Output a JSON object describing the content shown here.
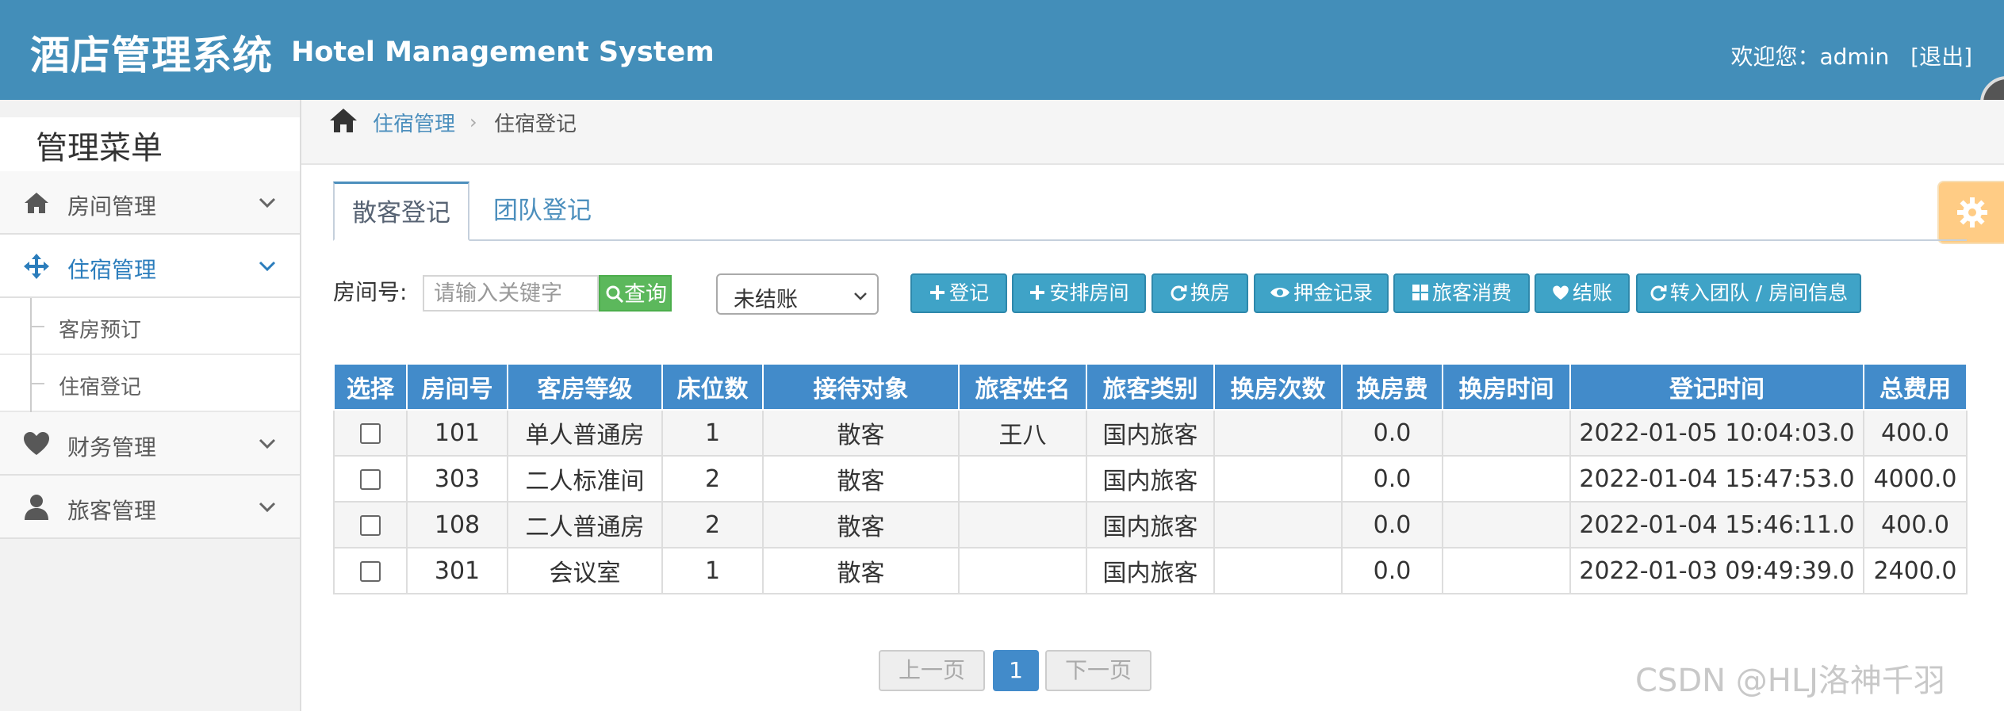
{
  "header": {
    "title_cn": "酒店管理系统",
    "title_en": "Hotel Management System",
    "welcome": "欢迎您：admin",
    "logout": "[退出]"
  },
  "sidebar": {
    "title": "管理菜单",
    "items": [
      {
        "label": "房间管理",
        "icon": "home-icon"
      },
      {
        "label": "住宿管理",
        "icon": "move-icon",
        "active": true
      },
      {
        "label": "财务管理",
        "icon": "heart-icon"
      },
      {
        "label": "旅客管理",
        "icon": "user-icon"
      }
    ],
    "subitems": [
      {
        "label": "客房预订"
      },
      {
        "label": "住宿登记"
      }
    ]
  },
  "breadcrumb": {
    "parent": "住宿管理",
    "current": "住宿登记"
  },
  "tabs": [
    {
      "label": "散客登记",
      "active": true
    },
    {
      "label": "团队登记",
      "active": false
    }
  ],
  "search": {
    "label": "房间号:",
    "placeholder": "请输入关键字",
    "button": "查询"
  },
  "status_select": {
    "value": "未结账"
  },
  "actions": [
    {
      "label": "登记",
      "icon": "plus-icon"
    },
    {
      "label": "安排房间",
      "icon": "plus-icon"
    },
    {
      "label": "换房",
      "icon": "refresh-icon"
    },
    {
      "label": "押金记录",
      "icon": "eye-icon"
    },
    {
      "label": "旅客消费",
      "icon": "grid-icon"
    },
    {
      "label": "结账",
      "icon": "heart-icon"
    },
    {
      "label": "转入团队 / 房间信息",
      "icon": "refresh-icon"
    }
  ],
  "table": {
    "columns": [
      "选择",
      "房间号",
      "客房等级",
      "床位数",
      "接待对象",
      "旅客姓名",
      "旅客类别",
      "换房次数",
      "换房费",
      "换房时间",
      "登记时间",
      "总费用"
    ],
    "rows": [
      [
        "",
        "101",
        "单人普通房",
        "1",
        "散客",
        "王八",
        "国内旅客",
        "",
        "0.0",
        "",
        "2022-01-05 10:04:03.0",
        "400.0"
      ],
      [
        "",
        "303",
        "二人标准间",
        "2",
        "散客",
        "",
        "国内旅客",
        "",
        "0.0",
        "",
        "2022-01-04 15:47:53.0",
        "4000.0"
      ],
      [
        "",
        "108",
        "二人普通房",
        "2",
        "散客",
        "",
        "国内旅客",
        "",
        "0.0",
        "",
        "2022-01-04 15:46:11.0",
        "400.0"
      ],
      [
        "",
        "301",
        "会议室",
        "1",
        "散客",
        "",
        "国内旅客",
        "",
        "0.0",
        "",
        "2022-01-03 09:49:39.0",
        "2400.0"
      ]
    ]
  },
  "pagination": {
    "prev": "上一页",
    "current": "1",
    "next": "下一页"
  },
  "watermark": "CSDN @HLJ洛神千羽",
  "colors": {
    "header_bg": "#438eb9",
    "table_header": "#428bca",
    "action_button": "#3fa3c7",
    "query_button": "#5cb85c",
    "link": "#4c8fbd"
  }
}
